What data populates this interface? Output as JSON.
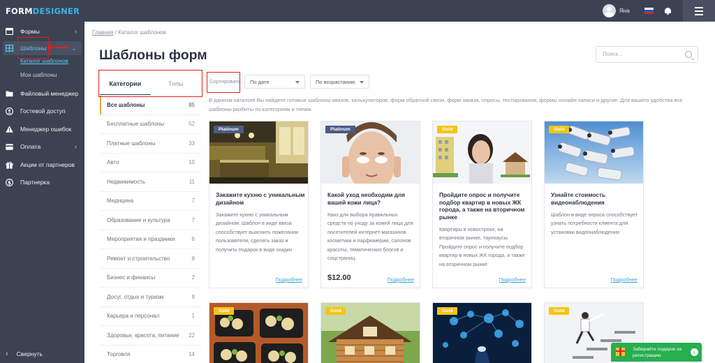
{
  "app": {
    "logo_part1": "FORM",
    "logo_part2": "DESIGNER"
  },
  "topbar": {
    "username": "Яна"
  },
  "sidebar": {
    "items": [
      {
        "label": "Формы",
        "icon": "forms-icon",
        "has_chevron": true
      },
      {
        "label": "Шаблоны",
        "icon": "templates-icon",
        "has_chevron": true,
        "active": true
      },
      {
        "label": "Файловый менеджер",
        "icon": "folder-icon"
      },
      {
        "label": "Гостевой доступ",
        "icon": "user-circle-icon"
      },
      {
        "label": "Менеджер ошибок",
        "icon": "warning-icon"
      },
      {
        "label": "Оплата",
        "icon": "payment-icon",
        "has_chevron": true
      },
      {
        "label": "Акции от партнеров",
        "icon": "gift-icon"
      },
      {
        "label": "Партнерка",
        "icon": "dollar-icon"
      }
    ],
    "subitems": [
      {
        "label": "Каталог шаблонов",
        "current": true
      },
      {
        "label": "Мои шаблоны"
      }
    ],
    "collapse_label": "Свернуть",
    "chevron": "‹",
    "expanded_chevron": "⌄"
  },
  "breadcrumb": {
    "home": "Главная",
    "separator": "/",
    "current": "Каталог шаблонов"
  },
  "page": {
    "title": "Шаблоны форм",
    "search_placeholder": "Поиск..."
  },
  "tabs": [
    {
      "label": "Категории",
      "active": true
    },
    {
      "label": "Типы"
    }
  ],
  "categories": [
    {
      "label": "Все шаблоны",
      "count": "85",
      "active": true
    },
    {
      "label": "Бесплатные шаблоны",
      "count": "52"
    },
    {
      "label": "Платные шаблоны",
      "count": "33"
    },
    {
      "label": "Авто",
      "count": "10"
    },
    {
      "label": "Недвижимость",
      "count": "11"
    },
    {
      "label": "Медицина",
      "count": "7"
    },
    {
      "label": "Образование и культура",
      "count": "7"
    },
    {
      "label": "Мероприятия и праздники",
      "count": "6"
    },
    {
      "label": "Ремонт и строительство",
      "count": "8"
    },
    {
      "label": "Бизнес и финансы",
      "count": "2"
    },
    {
      "label": "Досуг, отдых и туризм",
      "count": "8"
    },
    {
      "label": "Карьера и персонал",
      "count": "1"
    },
    {
      "label": "Здоровье, красота, питание",
      "count": "22"
    },
    {
      "label": "Торговля",
      "count": "14"
    }
  ],
  "sort": {
    "label": "Сортировать",
    "by": "По дате",
    "order": "По возрастанию"
  },
  "intro": "В данном каталоге Вы найдете готовые шаблоны квизов, калькуляторов, форм обратной связи, форм заказа, опросы, тестирования, формы онлайн-записи и другие. Для вашего удобства все шаблоны разбиты по категориям и типам.",
  "cards": [
    {
      "badge": "Platinum",
      "title": "Закажите кухню с уникальным дизайном",
      "description": "Закажите кухню с уникальным дизайном. Шаблон в виде квиза способствует выяснить пожелания пользователя, сделать заказ и получить подарок в виде скидки",
      "price": "",
      "more": "Подробнее",
      "image": "kitchen"
    },
    {
      "badge": "Platinum",
      "title": "Какой уход необходим для вашей кожи лица?",
      "description": "Квиз для выбора правильных средств по уходу за кожей лица для посетителей интернет-магазинов косметики и парфюмерии, салонов красоты, тематических блогов и соцстраниц.",
      "price": "$12.00",
      "more": "Подробнее",
      "image": "face"
    },
    {
      "badge": "Gold",
      "title": "Пройдите опрос и получите подбор квартир в новых ЖК города, а также на вторичном рынке",
      "description": "Квартиры в новостроях, на вторичном рынке, таунхаусы. Пройдите опрос и получите подбор квартир в новых ЖК города, а также на вторичном рынке",
      "price": "",
      "more": "Подробнее",
      "image": "realty"
    },
    {
      "badge": "Gold",
      "title": "Узнайте стоимость видеонаблюдения",
      "description": "Шаблон в виде опроса способствует узнать потребности клиента для установки видеонаблюдения",
      "price": "",
      "more": "Подробнее",
      "image": "cameras"
    }
  ],
  "cards_row2": [
    {
      "badge": "Gold",
      "image": "food"
    },
    {
      "badge": "Gold",
      "image": "house"
    },
    {
      "badge": "Gold",
      "image": "bulbs"
    },
    {
      "badge": "Gold",
      "image": "stairs"
    }
  ],
  "gift": {
    "text": "Забирайте подарок за регистрацию",
    "arrow": "›"
  },
  "colors": {
    "sidebar_bg": "#3b4252",
    "accent": "#5ac8f0",
    "platinum": "#4c5a85",
    "gold": "#f4c418",
    "gift_bg": "#27ae4f",
    "highlight_box": "#e0201c"
  }
}
